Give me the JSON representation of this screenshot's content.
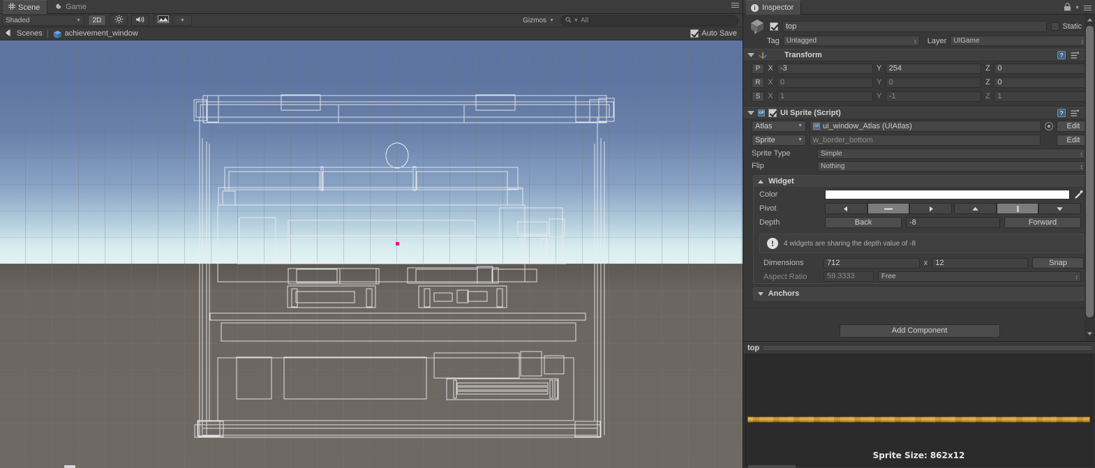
{
  "scene_panel": {
    "tabs": [
      {
        "label": "Scene",
        "icon": "grid-icon",
        "active": true
      },
      {
        "label": "Game",
        "icon": "moon-icon",
        "active": false
      }
    ],
    "toolbar": {
      "shading_mode": "Shaded",
      "view_2d": "2D",
      "lighting_icon": "sun-icon",
      "audio_icon": "speaker-icon",
      "fx_icon": "image-fx-icon",
      "fx_caret": "▾",
      "gizmos_label": "Gizmos",
      "gizmos_caret": "▾",
      "search_placeholder": "All",
      "search_icon": "search-icon"
    },
    "breadcrumb": {
      "back_icon": "back-arrow-icon",
      "scenes_label": "Scenes",
      "separator": "|",
      "scene_icon": "cube-icon",
      "scene_name": "achievement_window",
      "auto_save_label": "Auto Save",
      "auto_save_checked": true
    },
    "viewport": {
      "sky_top_color": "#5d74a0",
      "sky_horizon_color": "#dff1f2",
      "ground_color": "#6f6963",
      "wire_color": "#e8ecef",
      "selection_marker_color": "#f0148c"
    }
  },
  "inspector": {
    "tab_label": "Inspector",
    "tab_icon": "info-icon",
    "lock_icon": "lock-icon",
    "menu_icon": "hamburger-icon",
    "object": {
      "icon": "cube-icon",
      "enabled": true,
      "name": "top",
      "static_label": "Static",
      "static_checked": false,
      "tag_label": "Tag",
      "tag_value": "Untagged",
      "layer_label": "Layer",
      "layer_value": "UIGame"
    },
    "transform": {
      "title": "Transform",
      "icon": "transform-axis-icon",
      "help_icon": "help-icon",
      "preset_icon": "preset-icon",
      "gear_icon": "gear-icon",
      "rows": [
        {
          "btn": "P",
          "dim": false,
          "x_label": "X",
          "x": "-3",
          "y_label": "Y",
          "y": "254",
          "z_label": "Z",
          "z": "0"
        },
        {
          "btn": "R",
          "dim": true,
          "x_label": "X",
          "x": "0",
          "y_label": "Y",
          "y": "0",
          "z_label": "Z",
          "z": "0"
        },
        {
          "btn": "S",
          "dim": true,
          "x_label": "X",
          "x": "1",
          "y_label": "Y",
          "y": "-1",
          "z_label": "Z",
          "z": "1"
        }
      ]
    },
    "ui_sprite": {
      "title": "UI Sprite (Script)",
      "icon": "cs-script-icon",
      "enabled": true,
      "help_icon": "help-icon",
      "preset_icon": "preset-icon",
      "gear_icon": "gear-icon",
      "atlas_label": "Atlas",
      "atlas_value": "ui_window_Atlas (UIAtlas)",
      "atlas_edit": "Edit",
      "atlas_picker_icon": "object-picker-icon",
      "sprite_label": "Sprite",
      "sprite_value": "w_border_bottom",
      "sprite_edit": "Edit",
      "sprite_type_label": "Sprite Type",
      "sprite_type_value": "Simple",
      "flip_label": "Flip",
      "flip_value": "Nothing"
    },
    "widget": {
      "title": "Widget",
      "color_label": "Color",
      "color_value": "#ffffff",
      "eyedropper_icon": "eyedropper-icon",
      "pivot_label": "Pivot",
      "pivot_horizontal": [
        {
          "icon": "arrow-left-icon",
          "selected": false
        },
        {
          "icon": "minus-icon",
          "selected": true
        },
        {
          "icon": "arrow-right-icon",
          "selected": false
        }
      ],
      "pivot_vertical": [
        {
          "icon": "arrow-up-icon",
          "selected": false
        },
        {
          "icon": "bar-icon",
          "selected": true
        },
        {
          "icon": "arrow-down-icon",
          "selected": false
        }
      ],
      "depth_label": "Depth",
      "depth_back": "Back",
      "depth_value": "-8",
      "depth_forward": "Forward",
      "warning_icon": "warning-icon",
      "warning_text": "4 widgets are sharing the depth value of -8",
      "dimensions_label": "Dimensions",
      "dimensions_width": "712",
      "dimensions_x": "x",
      "dimensions_height": "12",
      "snap_label": "Snap",
      "aspect_label": "Aspect Ratio",
      "aspect_value": "59.3333",
      "aspect_mode": "Free",
      "anchors_title": "Anchors"
    },
    "add_component_label": "Add Component",
    "scrollbar": {
      "up_icon": "scroll-up-icon",
      "down_icon": "scroll-down-icon"
    },
    "preview": {
      "title": "top",
      "sprite_size_label": "Sprite Size: 862x12",
      "sprite_color": "#d4a23c"
    }
  }
}
